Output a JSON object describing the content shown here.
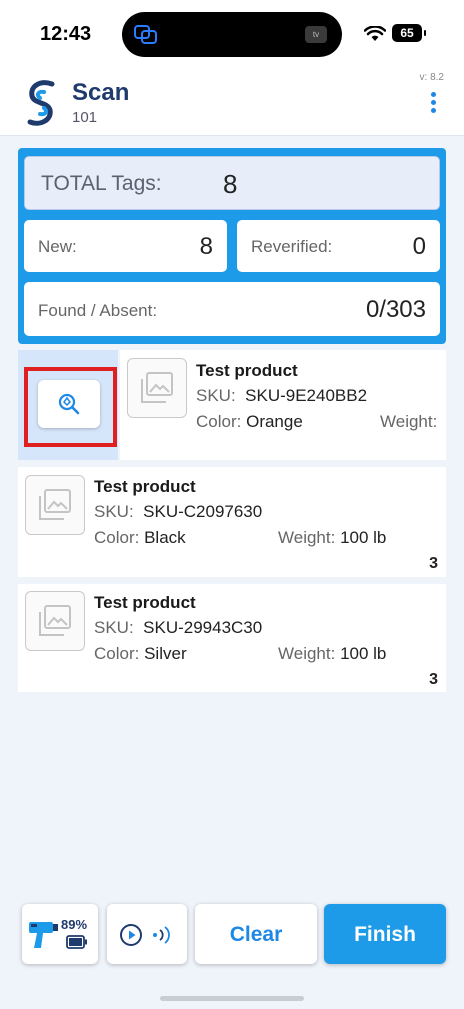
{
  "status_bar": {
    "time": "12:43",
    "battery": "65",
    "island_badge": "tv"
  },
  "header": {
    "title": "Scan",
    "subtitle": "101",
    "version": "v: 8.2"
  },
  "summary": {
    "total_label": "TOTAL Tags:",
    "total_value": "8",
    "new_label": "New:",
    "new_value": "8",
    "reverified_label": "Reverified:",
    "reverified_value": "0",
    "found_label": "Found / Absent:",
    "found_value": "0/303"
  },
  "products": [
    {
      "name": "Test product",
      "sku_label": "SKU:",
      "sku": "SKU-9E240BB2",
      "color_label": "Color:",
      "color": "Orange",
      "weight_label": "Weight:",
      "weight": "",
      "qty": ""
    },
    {
      "name": "Test product",
      "sku_label": "SKU:",
      "sku": "SKU-C2097630",
      "color_label": "Color:",
      "color": "Black",
      "weight_label": "Weight:",
      "weight": "100 lb",
      "qty": "3"
    },
    {
      "name": "Test product",
      "sku_label": "SKU:",
      "sku": "SKU-29943C30",
      "color_label": "Color:",
      "color": "Silver",
      "weight_label": "Weight:",
      "weight": "100 lb",
      "qty": "3"
    }
  ],
  "toolbar": {
    "scanner_battery": "89%",
    "clear_label": "Clear",
    "finish_label": "Finish"
  },
  "colors": {
    "accent": "#1e9be8",
    "brand": "#1f3a6d",
    "highlight": "#e02020"
  },
  "icons": [
    "scan-logo-icon",
    "kebab-menu-icon",
    "image-placeholder-icon",
    "locate-tag-icon",
    "scanner-gun-icon",
    "battery-icon",
    "play-icon",
    "rfid-signal-icon"
  ]
}
